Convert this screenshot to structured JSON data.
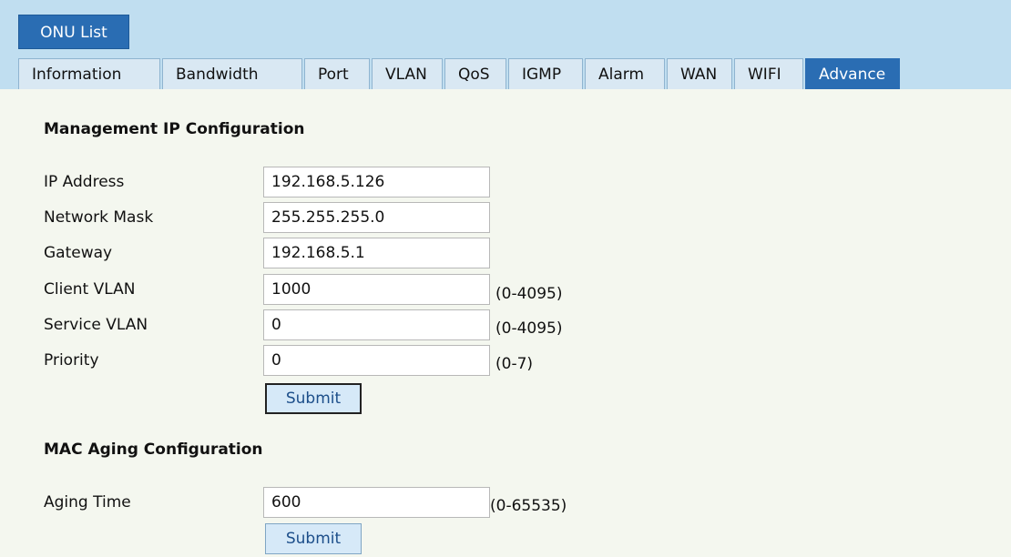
{
  "header": {
    "onu_list_label": "ONU List",
    "tabs": [
      {
        "label": "Information",
        "active": false
      },
      {
        "label": "Bandwidth",
        "active": false
      },
      {
        "label": "Port",
        "active": false
      },
      {
        "label": "VLAN",
        "active": false
      },
      {
        "label": "QoS",
        "active": false
      },
      {
        "label": "IGMP",
        "active": false
      },
      {
        "label": "Alarm",
        "active": false
      },
      {
        "label": "WAN",
        "active": false
      },
      {
        "label": "WIFI",
        "active": false
      },
      {
        "label": "Advance",
        "active": true
      }
    ]
  },
  "management": {
    "title": "Management IP Configuration",
    "ip_label": "IP Address",
    "ip_value": "192.168.5.126",
    "mask_label": "Network Mask",
    "mask_value": "255.255.255.0",
    "gateway_label": "Gateway",
    "gateway_value": "192.168.5.1",
    "client_vlan_label": "Client VLAN",
    "client_vlan_value": "1000",
    "client_vlan_range": "(0-4095)",
    "service_vlan_label": "Service VLAN",
    "service_vlan_value": "0",
    "service_vlan_range": "(0-4095)",
    "priority_label": "Priority",
    "priority_value": "0",
    "priority_range": "(0-7)",
    "submit_label": "Submit"
  },
  "mac_aging": {
    "title": "MAC Aging Configuration",
    "aging_label": "Aging Time",
    "aging_value": "600",
    "aging_range": "(0-65535)",
    "submit_label": "Submit"
  },
  "colors": {
    "header_bg": "#c0def0",
    "accent": "#2a6db3",
    "page_bg": "#f4f7ef"
  }
}
